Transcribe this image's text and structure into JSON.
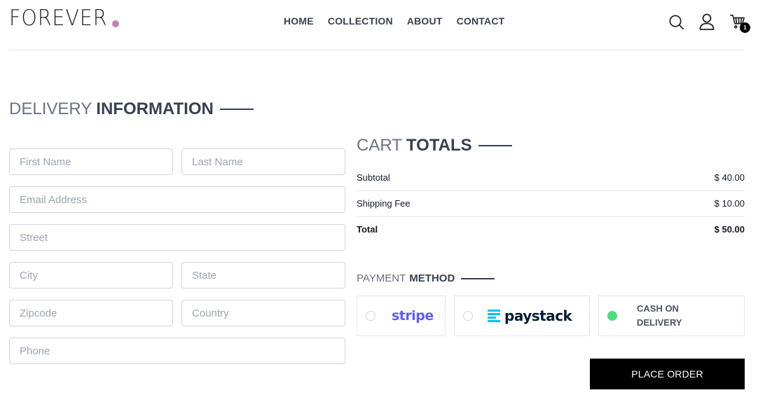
{
  "brand": {
    "name": "FOREVER",
    "dot_color": "#c586a5"
  },
  "nav": {
    "items": [
      "HOME",
      "COLLECTION",
      "ABOUT",
      "CONTACT"
    ]
  },
  "header_icons": {
    "search": "search-icon",
    "profile": "profile-icon",
    "cart": "cart-icon",
    "cart_count": "1"
  },
  "delivery": {
    "title_light": "DELIVERY",
    "title_bold": "INFORMATION",
    "fields": {
      "first_name": "First Name",
      "last_name": "Last Name",
      "email": "Email Address",
      "street": "Street",
      "city": "City",
      "state": "State",
      "zipcode": "Zipcode",
      "country": "Country",
      "phone": "Phone"
    }
  },
  "cart_totals": {
    "title_light": "CART",
    "title_bold": "TOTALS",
    "rows": [
      {
        "label": "Subtotal",
        "value": "$ 40.00"
      },
      {
        "label": "Shipping Fee",
        "value": "$ 10.00"
      },
      {
        "label": "Total",
        "value": "$ 50.00"
      }
    ]
  },
  "payment": {
    "title_light": "PAYMENT",
    "title_bold": "METHOD",
    "options": [
      {
        "name": "stripe",
        "label": "stripe",
        "selected": false
      },
      {
        "name": "paystack",
        "label": "paystack",
        "selected": false
      },
      {
        "name": "cod",
        "label": "CASH ON DELIVERY",
        "selected": true
      }
    ],
    "selected_color": "#4ade80",
    "place_order_label": "PLACE ORDER"
  }
}
